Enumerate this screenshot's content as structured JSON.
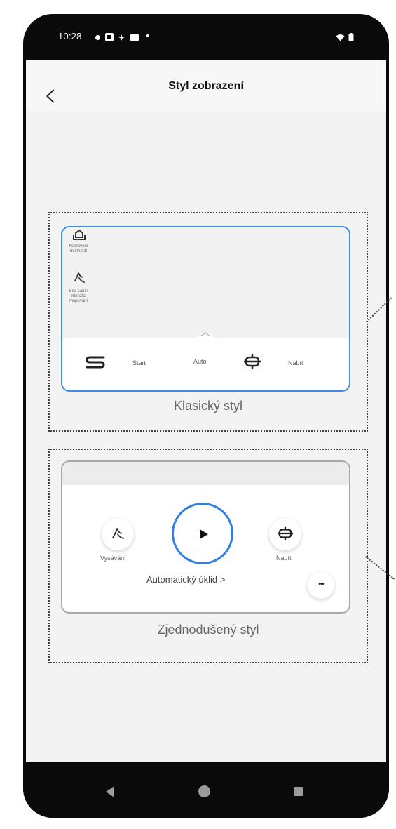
{
  "status_bar": {
    "time": "10:28"
  },
  "header": {
    "title": "Styl zobrazení"
  },
  "classic": {
    "caption": "Klasický styl",
    "settings_label": "Nastavení místností",
    "suction_label": "Síla sání / intenzita mopování",
    "start_label": "Start",
    "auto_label": "Auto",
    "charge_label": "Nabít"
  },
  "simple": {
    "caption": "Zjednodušený styl",
    "vacuum_label": "Vysávání",
    "charge_label": "Nabít",
    "auto_clean_label": "Automatický úklid >",
    "more_label": "•••"
  },
  "colors": {
    "accent": "#2f80e6",
    "background": "#f3f3f3"
  }
}
